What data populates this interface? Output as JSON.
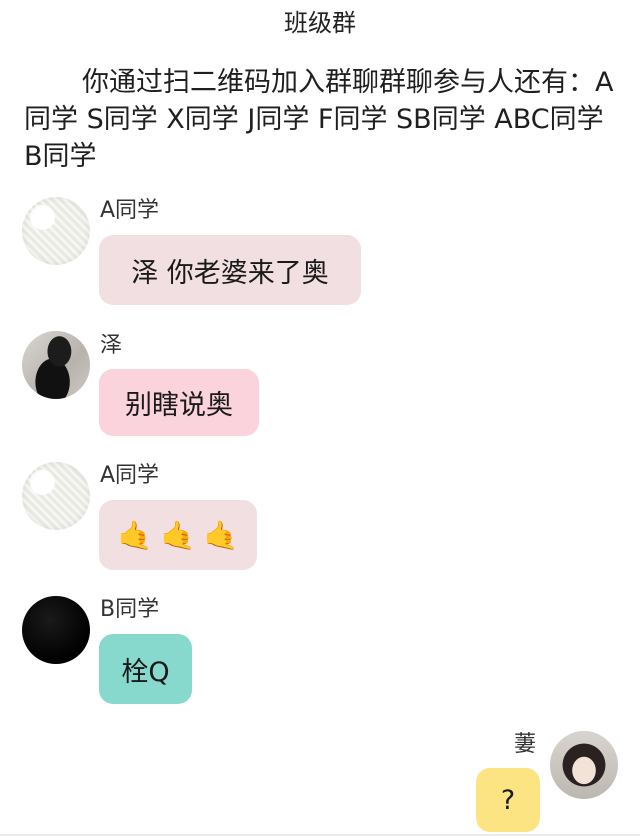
{
  "header": {
    "title": "班级群"
  },
  "notice": {
    "text": "你通过扫二维码加入群聊群聊参与人还有：A同学 S同学 X同学 J同学 F同学 SB同学 ABC同学 B同学"
  },
  "messages": [
    {
      "sender": "A同学",
      "text": "泽 你老婆来了奥",
      "bubble_color": "#f1dfe1",
      "avatar": "knit-texture-avatar"
    },
    {
      "sender": "泽",
      "text": "别瞎说奥",
      "bubble_color": "#fbd3dd",
      "avatar": "person-photo-avatar"
    },
    {
      "sender": "A同学",
      "emoji": [
        "🤙",
        "🤙",
        "🤙"
      ],
      "bubble_color": "#f1dfe1",
      "avatar": "knit-texture-avatar"
    },
    {
      "sender": "B同学",
      "text": "栓Q",
      "bubble_color": "#87d8cd",
      "avatar": "black-avatar"
    },
    {
      "sender": "萋",
      "text": "?",
      "bubble_color": "#fde483",
      "avatar": "girl-photo-avatar",
      "own": true
    }
  ]
}
